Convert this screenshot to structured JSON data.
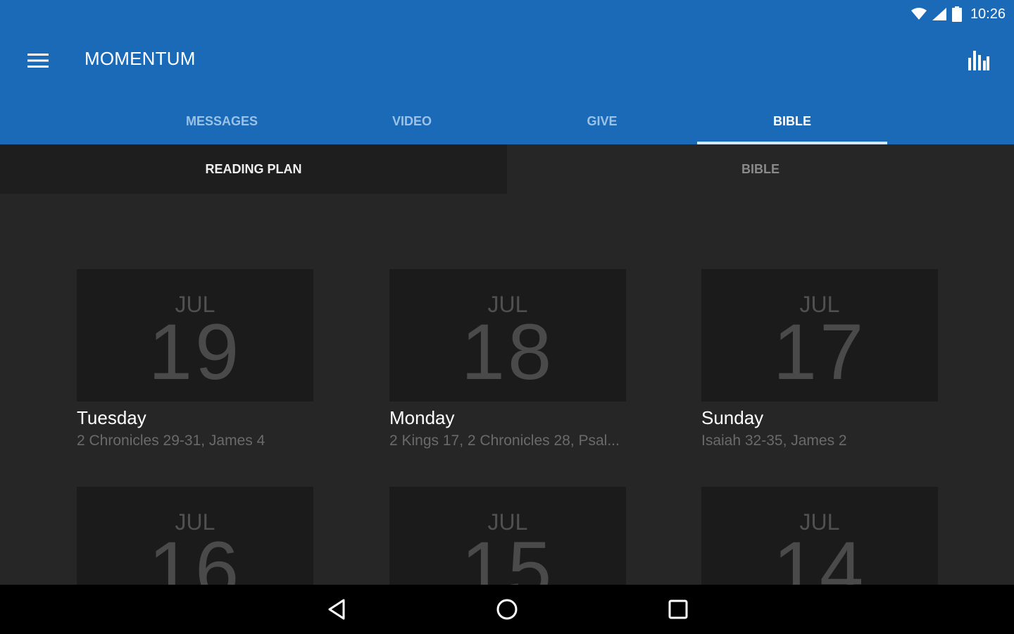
{
  "status_bar": {
    "time": "10:26"
  },
  "app_bar": {
    "title": "MOMENTUM",
    "menu_icon": "hamburger-menu-icon",
    "action_icon": "bar-chart-icon"
  },
  "tabs": [
    {
      "label": "MESSAGES",
      "active": false
    },
    {
      "label": "VIDEO",
      "active": false
    },
    {
      "label": "GIVE",
      "active": false
    },
    {
      "label": "BIBLE",
      "active": true
    }
  ],
  "subtabs": [
    {
      "label": "READING PLAN",
      "active": true
    },
    {
      "label": "BIBLE",
      "active": false
    }
  ],
  "readings": [
    {
      "month": "JUL",
      "day": "19",
      "weekday": "Tuesday",
      "passage": "2 Chronicles 29-31, James 4"
    },
    {
      "month": "JUL",
      "day": "18",
      "weekday": "Monday",
      "passage": "2 Kings 17, 2 Chronicles 28, Psal..."
    },
    {
      "month": "JUL",
      "day": "17",
      "weekday": "Sunday",
      "passage": "Isaiah 32-35, James 2"
    },
    {
      "month": "JUL",
      "day": "16",
      "weekday": "",
      "passage": ""
    },
    {
      "month": "JUL",
      "day": "15",
      "weekday": "",
      "passage": ""
    },
    {
      "month": "JUL",
      "day": "14",
      "weekday": "",
      "passage": ""
    }
  ],
  "nav_bar": {
    "back_icon": "back-icon",
    "home_icon": "home-icon",
    "recents_icon": "recents-icon"
  },
  "colors": {
    "primary": "#1a6ab7",
    "background": "#262626",
    "card": "#1b1b1b"
  }
}
